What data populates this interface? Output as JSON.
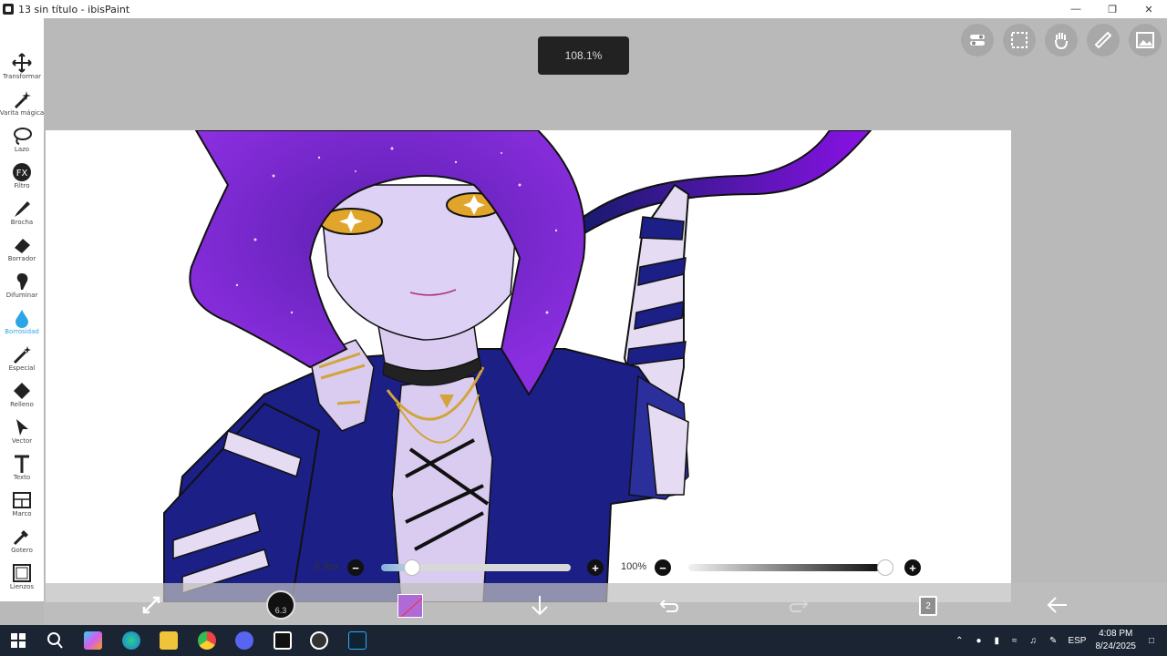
{
  "window": {
    "title": "13 sin título - ibisPaint"
  },
  "toolbar": {
    "items": [
      {
        "label": "Transformar",
        "icon": "move-icon"
      },
      {
        "label": "Varita mágica",
        "icon": "magic-wand-icon"
      },
      {
        "label": "Lazo",
        "icon": "lasso-icon"
      },
      {
        "label": "Filtro",
        "icon": "fx-icon"
      },
      {
        "label": "Brocha",
        "icon": "brush-icon"
      },
      {
        "label": "Borrador",
        "icon": "eraser-icon"
      },
      {
        "label": "Difuminar",
        "icon": "smudge-icon"
      },
      {
        "label": "Borrosidad",
        "icon": "blur-drop-icon"
      },
      {
        "label": "Especial",
        "icon": "special-pen-icon"
      },
      {
        "label": "Relleno",
        "icon": "fill-bucket-icon"
      },
      {
        "label": "Vector",
        "icon": "vector-cursor-icon"
      },
      {
        "label": "Texto",
        "icon": "text-icon"
      },
      {
        "label": "Marco",
        "icon": "frame-icon"
      },
      {
        "label": "Gotero",
        "icon": "eyedropper-icon"
      },
      {
        "label": "Lienzos",
        "icon": "canvas-icon"
      }
    ],
    "active_index": 7,
    "accent_color": "#2aa6e6"
  },
  "zoom": {
    "label": "108.1%"
  },
  "brush": {
    "size_label": "6.3px",
    "size_badge": "6.3",
    "size_fraction": 0.07
  },
  "opacity": {
    "label": "100%",
    "value_fraction": 1.0
  },
  "layers": {
    "count": "2"
  },
  "color": {
    "current": "#b06ad6"
  },
  "taskbar": {
    "lang": "ESP",
    "time": "4:08 PM",
    "date": "8/24/2025"
  }
}
